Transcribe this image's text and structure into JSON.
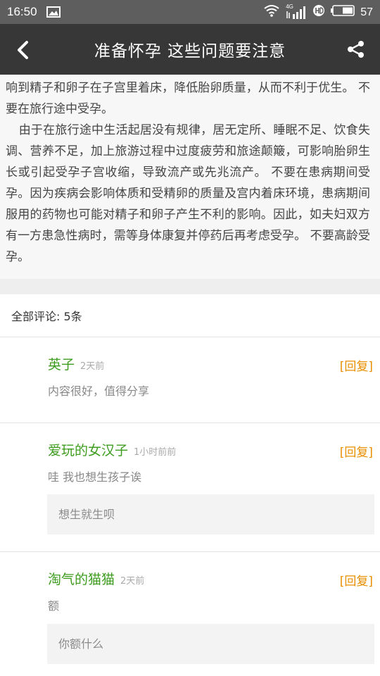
{
  "status_bar": {
    "time": "16:50",
    "network_label": "4G",
    "battery": "57"
  },
  "header": {
    "title": "准备怀孕 这些问题要注意"
  },
  "article": {
    "paragraphs": [
      "因为长期的疲劳、紧张与营养不良等会影响精子与卵子质量，也会影响到精子和卵子在子宫里着床，降低胎卵质量，从而不利于优生。 不要在旅行途中受孕。",
      "由于在旅行途中生活起居没有规律，居无定所、睡眠不足、饮食失调、营养不足，加上旅游过程中过度疲劳和旅途颠簸，可影响胎卵生长或引起受孕子宫收缩，导致流产或先兆流产。 不要在患病期间受孕。因为疾病会影响体质和受精卵的质量及宫内着床环境，患病期间服用的药物也可能对精子和卵子产生不利的影响。因此，如夫妇双方有一方患急性病时，需等身体康复并停药后再考虑受孕。 不要高龄受孕。"
    ]
  },
  "comments_header": {
    "label": "全部评论: 5条"
  },
  "comments": [
    {
      "name": "英子",
      "time": "2天前",
      "reply": "[回复]",
      "text": "内容很好，值得分享"
    },
    {
      "name": "爱玩的女汉子",
      "time": "1小时前前",
      "reply": "[回复]",
      "text": "哇 我也想生孩子诶",
      "sub_reply": "想生就生呗"
    },
    {
      "name": "淘气的猫猫",
      "time": "2天前",
      "reply": "[回复]",
      "text": "额",
      "sub_reply": "你额什么"
    }
  ],
  "colors": {
    "header_bg": "#373737",
    "status_bg": "#5e5e5e",
    "name_green": "#3d9c1e",
    "reply_orange": "#e88f00"
  },
  "icons": [
    "image-icon",
    "wifi-icon",
    "signal-icon",
    "hd-icon",
    "battery-icon",
    "back-icon",
    "share-icon"
  ]
}
